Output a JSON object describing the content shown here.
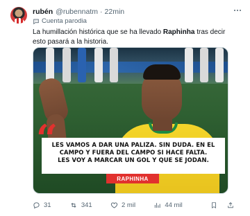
{
  "author": {
    "name": "rubén",
    "handle": "@rubennatm",
    "separator": "·",
    "time": "22min"
  },
  "parody_label": "Cuenta parodia",
  "tweet": {
    "text_before": "La humillación histórica que se ha llevado ",
    "text_bold": "Raphinha",
    "text_after": " tras decir esto pasará a la historia."
  },
  "media": {
    "quote_line_1": "LES VAMOS A DAR UNA PALIZA. SIN DUDA. EN EL",
    "quote_line_2": "CAMPO Y FUERA DEL CAMPO SI HACE FALTA.",
    "quote_line_3": "LES VOY A MARCAR UN GOL Y QUE SE JODAN.",
    "speaker_tag": "RAPHINHA",
    "colors": {
      "accent": "#e1312e",
      "jersey": "#f4d52a",
      "pitch": "#2f6032"
    }
  },
  "actions": {
    "replies": "31",
    "reposts": "341",
    "likes": "2 mil",
    "views": "44 mil"
  },
  "icons": [
    "more-icon",
    "parody-icon",
    "reply-icon",
    "repost-icon",
    "like-icon",
    "views-icon",
    "bookmark-icon",
    "share-icon"
  ]
}
